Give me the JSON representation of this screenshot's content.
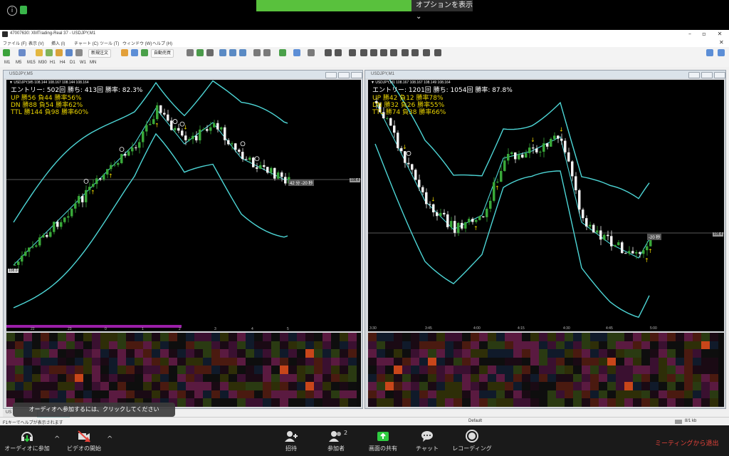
{
  "zoom": {
    "options_label": "オプションを表示 ⌄",
    "tooltip": "オーディオへ参加するには、クリックしてください",
    "buttons": {
      "audio": "オーディオに参加",
      "video": "ビデオの開始",
      "invite": "招待",
      "participants": "参加者",
      "participants_count": "2",
      "share": "画面の共有",
      "chat": "チャット",
      "record": "レコーディング"
    },
    "leave": "ミーティングから退出"
  },
  "mt4": {
    "title": "47007630: XMTrading-Real 37 - USDJPY,M1",
    "menu": [
      "ファイル (F)",
      "表示 (V)",
      "挿入 (I)",
      "チャート (C)",
      "ツール (T)",
      "ウィンドウ (W)",
      "ヘルプ (H)"
    ],
    "toolbar": {
      "new_order": "新規注文",
      "auto_trade": "自動売買"
    },
    "timeframes": [
      "M1",
      "M5",
      "M15",
      "M30",
      "H1",
      "H4",
      "D1",
      "W1",
      "MN"
    ],
    "status": {
      "help": "F1キーでヘルプが表示されます",
      "profile": "Default",
      "traffic": "8/1 kb"
    },
    "tabs_partial": "US"
  },
  "charts": [
    {
      "window_title": "USDJPY,M5",
      "symbol_line": "▼ USDJPY,M5  108.144 108.167 108.144 108.164",
      "hud": {
        "line1": "エントリー: 502回  勝ち: 413回  勝率: 82.3%",
        "line2": "UP  勝56 負44 勝率56%",
        "line3": "DN  勝88 負54 勝率62%",
        "line4": "TTL  勝144 負98 勝率60%"
      },
      "countdown": "42 分 -20 秒",
      "price_right": "108.4",
      "price_left": "108.0",
      "time_labels": [
        "22",
        "23",
        "0",
        "1",
        "2",
        "3",
        "4",
        "5"
      ]
    },
    {
      "window_title": "USDJPY,M1",
      "symbol_line": "▼ USDJPY,M1  108.167 108.167 108.149 108.164",
      "hud": {
        "line1": "エントリー: 1201回  勝ち: 1054回  勝率: 87.8%",
        "line2": "UP  勝42 負12 勝率78%",
        "line3": "DN  勝32 負26 勝率55%",
        "line4": "TTL  勝74 負38 勝率66%"
      },
      "countdown": "-20 秒",
      "price_right": "108.4",
      "time_labels": [
        "3:30",
        "3:45",
        "4:00",
        "4:15",
        "4:30",
        "4:45",
        "5:00"
      ]
    }
  ],
  "colors": {
    "band": "#4dd6d6",
    "bull": "#39a839",
    "bear": "#f2f2f2",
    "hud_yellow": "#e8d200",
    "zoom_green": "#59c13d",
    "leave_red": "#e8433a"
  }
}
